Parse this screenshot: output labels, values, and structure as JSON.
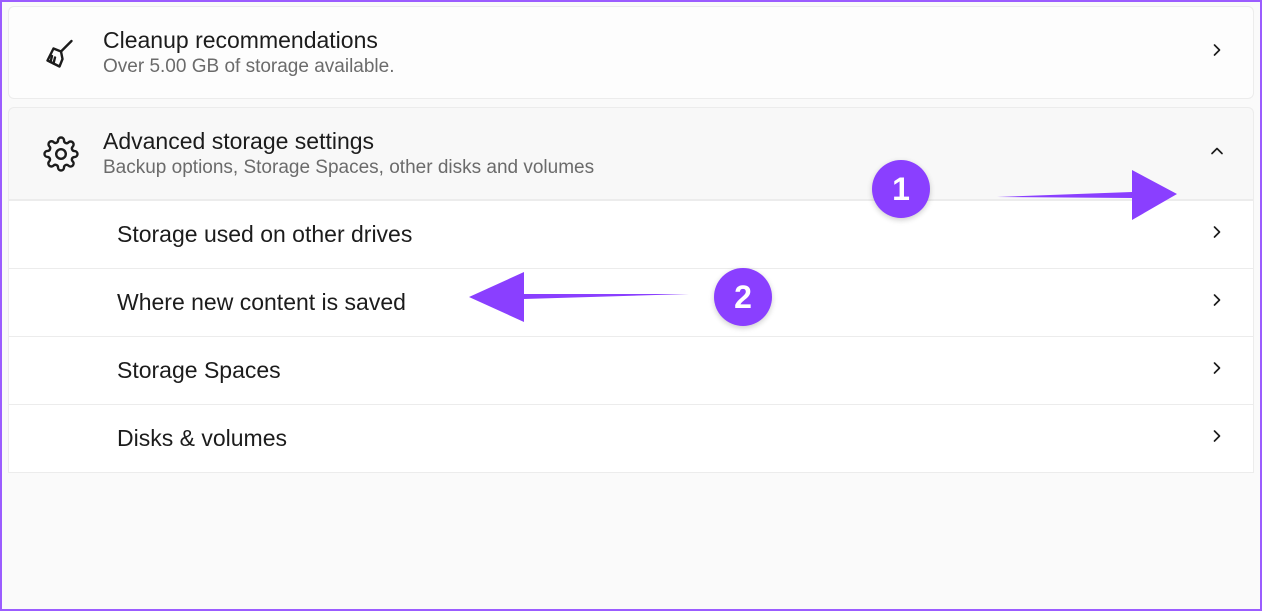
{
  "cleanup": {
    "title": "Cleanup recommendations",
    "subtitle": "Over 5.00 GB of storage available."
  },
  "advanced": {
    "title": "Advanced storage settings",
    "subtitle": "Backup options, Storage Spaces, other disks and volumes"
  },
  "subitems": {
    "storage_other": "Storage used on other drives",
    "where_saved": "Where new content is saved",
    "storage_spaces": "Storage Spaces",
    "disks_volumes": "Disks & volumes"
  },
  "annotations": {
    "badge1": "1",
    "badge2": "2"
  },
  "colors": {
    "accent": "#8a3fff",
    "border": "#9b5cff"
  }
}
